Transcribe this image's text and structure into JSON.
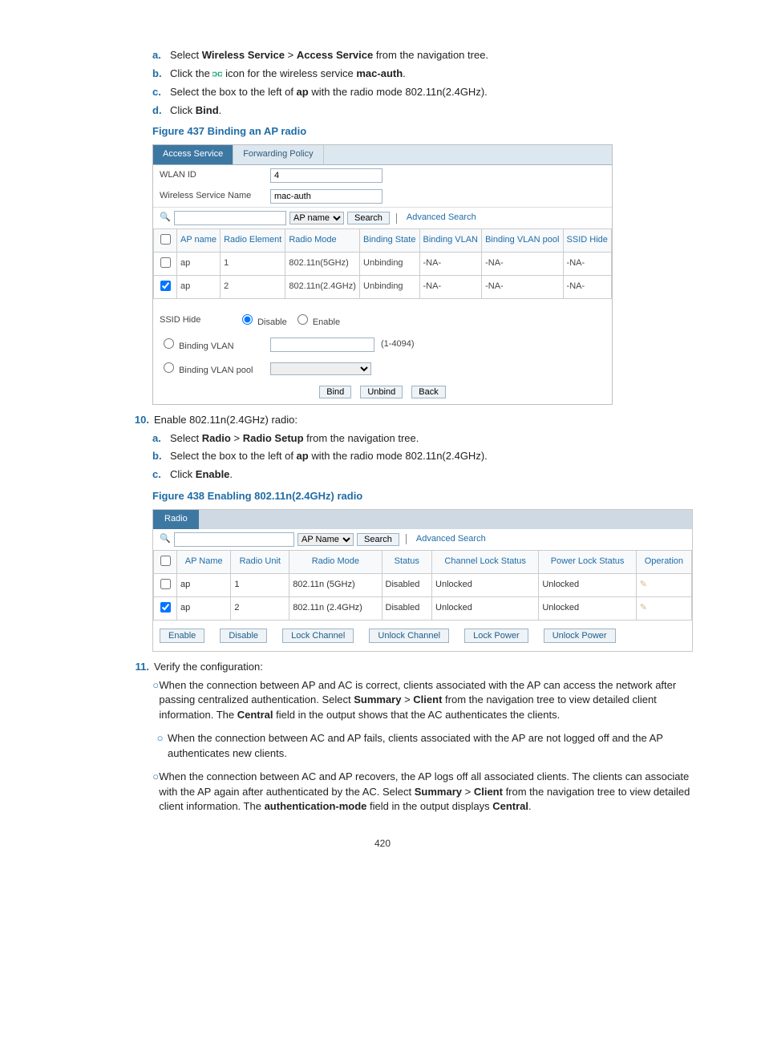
{
  "steps9": [
    {
      "m": "a.",
      "pre": "Select ",
      "b1": "Wireless Service",
      "mid": " > ",
      "b2": "Access Service",
      "post": " from the navigation tree."
    },
    {
      "m": "b.",
      "pre": "Click the ",
      "icon": "link-icon",
      "mid": " icon for the wireless service ",
      "b1": "mac-auth",
      "post": "."
    },
    {
      "m": "c.",
      "pre": "Select the box to the left of ",
      "b1": "ap",
      "post": " with the radio mode 802.11n(2.4GHz)."
    },
    {
      "m": "d.",
      "pre": "Click ",
      "b1": "Bind",
      "post": "."
    }
  ],
  "figcap437": "Figure 437 Binding an AP radio",
  "fig437": {
    "tabs": [
      "Access Service",
      "Forwarding Policy"
    ],
    "wlanid_label": "WLAN ID",
    "wlanid_val": "4",
    "svcname_label": "Wireless Service Name",
    "svcname_val": "mac-auth",
    "search_field": "AP name",
    "search_btn": "Search",
    "adv": "Advanced Search",
    "headers": [
      "",
      "AP name",
      "Radio Element",
      "Radio Mode",
      "Binding State",
      "Binding VLAN",
      "Binding VLAN pool",
      "SSID Hide"
    ],
    "rows": [
      {
        "chk": false,
        "ap": "ap",
        "re": "1",
        "rm": "802.11n(5GHz)",
        "bs": "Unbinding",
        "bv": "-NA-",
        "bp": "-NA-",
        "sh": "-NA-"
      },
      {
        "chk": true,
        "ap": "ap",
        "re": "2",
        "rm": "802.11n(2.4GHz)",
        "bs": "Unbinding",
        "bv": "-NA-",
        "bp": "-NA-",
        "sh": "-NA-"
      }
    ],
    "ssid_label": "SSID Hide",
    "ssid_disable": "Disable",
    "ssid_enable": "Enable",
    "bv_label": "Binding VLAN",
    "bv_hint": "(1-4094)",
    "bp_label": "Binding VLAN pool",
    "btns": [
      "Bind",
      "Unbind",
      "Back"
    ]
  },
  "step10_num": "10.",
  "step10_txt": "Enable 802.11n(2.4GHz) radio:",
  "steps10": [
    {
      "m": "a.",
      "pre": "Select ",
      "b1": "Radio",
      "mid": " > ",
      "b2": "Radio Setup",
      "post": " from the navigation tree."
    },
    {
      "m": "b.",
      "pre": "Select the box to the left of ",
      "b1": "ap",
      "post": " with the radio mode 802.11n(2.4GHz)."
    },
    {
      "m": "c.",
      "pre": "Click ",
      "b1": "Enable",
      "post": "."
    }
  ],
  "figcap438": "Figure 438 Enabling 802.11n(2.4GHz) radio",
  "fig438": {
    "tab": "Radio",
    "search_field": "AP Name",
    "search_btn": "Search",
    "adv": "Advanced Search",
    "headers": [
      "",
      "AP Name",
      "Radio Unit",
      "Radio Mode",
      "Status",
      "Channel Lock Status",
      "Power Lock Status",
      "Operation"
    ],
    "rows": [
      {
        "chk": false,
        "ap": "ap",
        "ru": "1",
        "rm": "802.11n (5GHz)",
        "st": "Disabled",
        "cl": "Unlocked",
        "pl": "Unlocked"
      },
      {
        "chk": true,
        "ap": "ap",
        "ru": "2",
        "rm": "802.11n (2.4GHz)",
        "st": "Disabled",
        "cl": "Unlocked",
        "pl": "Unlocked"
      }
    ],
    "btns": [
      "Enable",
      "Disable",
      "Lock Channel",
      "Unlock Channel",
      "Lock Power",
      "Unlock Power"
    ]
  },
  "step11_num": "11.",
  "step11_txt": "Verify the configuration:",
  "bullets": [
    {
      "pre": "When the connection between AP and AC is correct, clients associated with the AP can access the network after passing centralized authentication. Select ",
      "b1": "Summary",
      "mid1": " > ",
      "b2": "Client",
      "mid2": " from the navigation tree to view detailed client information. The ",
      "b3": "Central",
      "post": " field in the output shows that the AC authenticates the clients."
    },
    {
      "pre": "When the connection between AC and AP fails, clients associated with the AP are not logged off and the AP authenticates new clients."
    },
    {
      "pre": "When the connection between AC and AP recovers, the AP logs off all associated clients. The clients can associate with the AP again after authenticated by the AC. Select ",
      "b1": "Summary",
      "mid1": " > ",
      "b2": "Client",
      "mid2": " from the navigation tree to view detailed client information. The ",
      "b3": "authentication-mode",
      "post": " field in the output displays ",
      "b4": "Central",
      "post2": "."
    }
  ],
  "pagenum": "420"
}
